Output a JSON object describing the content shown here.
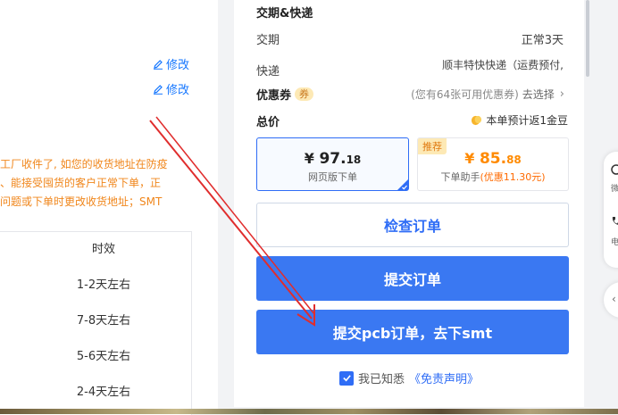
{
  "address": {
    "edit_label_1": "修改",
    "edit_label_2": "修改",
    "notice_lines": [
      "工厂收件了, 如您的收货地址在防疫",
      "、能接受囤货的客户正常下单，正",
      "问题或下单时更改收货地址；SMT"
    ]
  },
  "delivery_table": {
    "header": "时效",
    "rows": [
      "1-2天左右",
      "7-8天左右",
      "5-6天左右",
      "2-4天左右"
    ]
  },
  "order": {
    "section_title": "交期&快递",
    "lead_time_label": "交期",
    "lead_time_value": "正常3天",
    "courier_label": "快递",
    "courier_value": "顺丰特快快递（运费预付,",
    "coupon": {
      "label": "优惠券",
      "badge": "券",
      "info": "(您有64张可用优惠券)",
      "action": "去选择",
      "chevron": "›"
    },
    "total_label": "总价",
    "coin_text": "本单预计返1金豆",
    "web_price": {
      "currency": "¥",
      "integer": "97.",
      "decimal": "18",
      "caption": "网页版下单"
    },
    "helper_price": {
      "tag": "推荐",
      "currency": "¥",
      "integer": "85.",
      "decimal": "88",
      "caption_prefix": "下单助手",
      "caption_highlight": "(优惠11.30元)"
    },
    "check_button": "检查订单",
    "submit_button": "提交订单",
    "submit_pcb_button": "提交pcb订单，去下smt",
    "agree_text": "我已知悉",
    "disclaimer_link": "《免责声明》"
  },
  "side_widget": {
    "item1": "微",
    "item2": "电",
    "circle": "‹"
  },
  "colors": {
    "primary_blue": "#3a78f2",
    "link_blue": "#1677ff",
    "orange": "#ff8a00",
    "notice_orange": "#f0861b",
    "annotation_red": "#e02d2d"
  }
}
